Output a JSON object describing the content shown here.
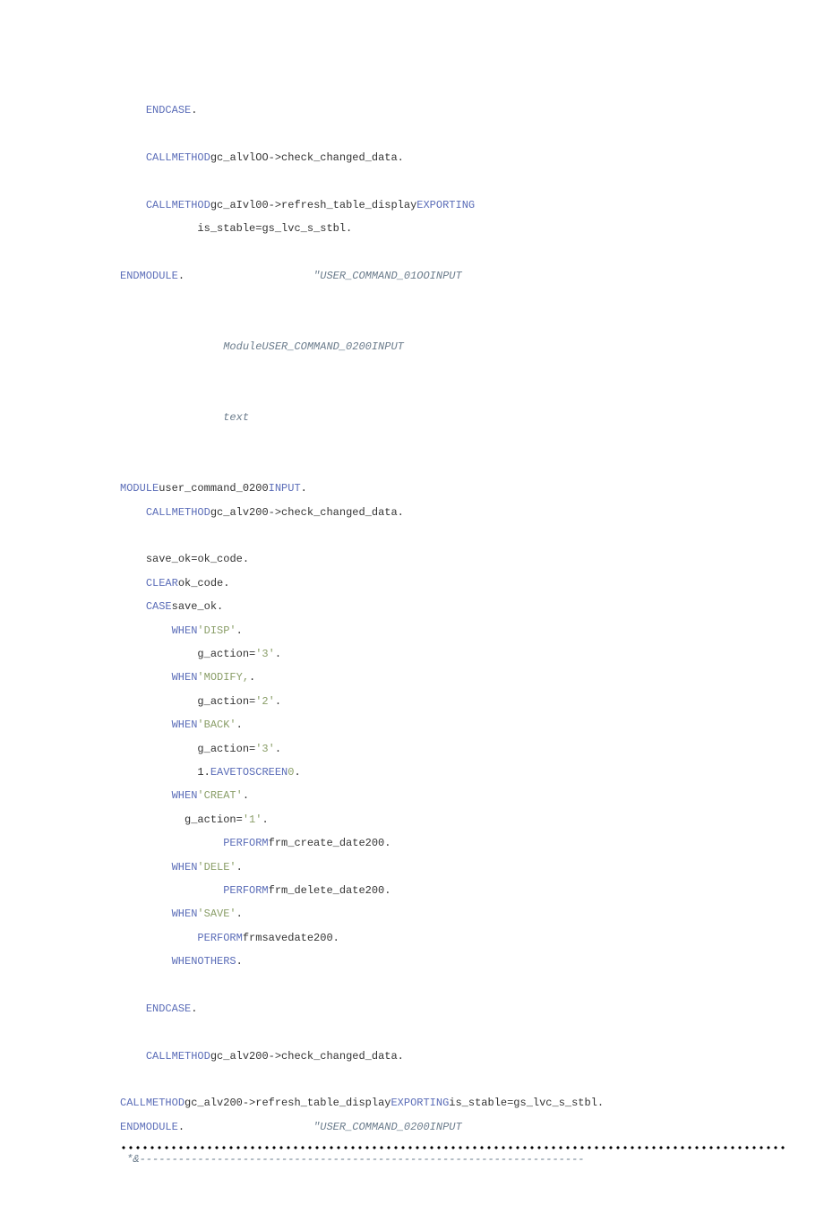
{
  "lines": [
    {
      "indent": 2,
      "segs": [
        {
          "t": "ENDCASE",
          "c": "kw"
        },
        {
          "t": "."
        }
      ]
    },
    {
      "blank": true
    },
    {
      "indent": 2,
      "segs": [
        {
          "t": "CALL",
          "c": "kw"
        },
        {
          "t": "METHOD",
          "c": "kw"
        },
        {
          "t": "gc_alvlOO->check_changed_data."
        }
      ]
    },
    {
      "blank": true
    },
    {
      "indent": 2,
      "segs": [
        {
          "t": "CALL",
          "c": "kw"
        },
        {
          "t": "METHOD",
          "c": "kw"
        },
        {
          "t": "gc_aIvl00->refresh_table_display"
        },
        {
          "t": "EXPORTING",
          "c": "kw"
        }
      ]
    },
    {
      "indent": 6,
      "segs": [
        {
          "t": "is_stable"
        },
        {
          "t": "="
        },
        {
          "t": "gs_lvc_s_stbl."
        }
      ]
    },
    {
      "blank": true
    },
    {
      "indent": 0,
      "segs": [
        {
          "t": "ENDMODULE",
          "c": "kw"
        },
        {
          "t": ".                    "
        },
        {
          "t": "\"USER_COMMAND_01OOINPUT",
          "c": "cmt"
        }
      ]
    },
    {
      "blank": true
    },
    {
      "blank": true
    },
    {
      "indent": 8,
      "segs": [
        {
          "t": "ModuleUSER_COMMAND_0200INPUT",
          "c": "cmt"
        }
      ]
    },
    {
      "blank": true
    },
    {
      "blank": true
    },
    {
      "indent": 8,
      "segs": [
        {
          "t": "text",
          "c": "cmt"
        }
      ]
    },
    {
      "blank": true
    },
    {
      "blank": true
    },
    {
      "indent": 0,
      "segs": [
        {
          "t": "MODULE",
          "c": "kw"
        },
        {
          "t": "user_command_0200"
        },
        {
          "t": "INPUT",
          "c": "kw"
        },
        {
          "t": "."
        }
      ]
    },
    {
      "indent": 2,
      "segs": [
        {
          "t": "CALL",
          "c": "kw"
        },
        {
          "t": "METHOD",
          "c": "kw"
        },
        {
          "t": "gc_alv200->check_changed_data."
        }
      ]
    },
    {
      "blank": true
    },
    {
      "indent": 2,
      "segs": [
        {
          "t": "save_ok"
        },
        {
          "t": "="
        },
        {
          "t": "ok_code."
        }
      ]
    },
    {
      "indent": 2,
      "segs": [
        {
          "t": "CLEAR",
          "c": "kw"
        },
        {
          "t": "ok_code."
        }
      ]
    },
    {
      "indent": 2,
      "segs": [
        {
          "t": "CASE",
          "c": "kw"
        },
        {
          "t": "save_ok."
        }
      ]
    },
    {
      "indent": 4,
      "segs": [
        {
          "t": "WHEN",
          "c": "kw"
        },
        {
          "t": "'DISP'",
          "c": "lit"
        },
        {
          "t": "."
        }
      ]
    },
    {
      "indent": 6,
      "segs": [
        {
          "t": "g_action"
        },
        {
          "t": "="
        },
        {
          "t": "'3'",
          "c": "lit"
        },
        {
          "t": "."
        }
      ]
    },
    {
      "indent": 4,
      "segs": [
        {
          "t": "WHEN",
          "c": "kw"
        },
        {
          "t": "'MODIFY,",
          "c": "lit"
        },
        {
          "t": "."
        }
      ]
    },
    {
      "indent": 6,
      "segs": [
        {
          "t": "g_action"
        },
        {
          "t": "="
        },
        {
          "t": "'2'",
          "c": "lit"
        },
        {
          "t": "."
        }
      ]
    },
    {
      "indent": 4,
      "segs": [
        {
          "t": "WHEN",
          "c": "kw"
        },
        {
          "t": "'BACK'",
          "c": "lit"
        },
        {
          "t": "."
        }
      ]
    },
    {
      "indent": 6,
      "segs": [
        {
          "t": "g_action"
        },
        {
          "t": "="
        },
        {
          "t": "'3'",
          "c": "lit"
        },
        {
          "t": "."
        }
      ]
    },
    {
      "indent": 6,
      "segs": [
        {
          "t": "1."
        },
        {
          "t": "EAVE",
          "c": "kw"
        },
        {
          "t": "TO",
          "c": "kw"
        },
        {
          "t": "SCREEN",
          "c": "kw"
        },
        {
          "t": "0",
          "c": "lit"
        },
        {
          "t": "."
        }
      ]
    },
    {
      "indent": 4,
      "segs": [
        {
          "t": "WHEN",
          "c": "kw"
        },
        {
          "t": "'CREAT'",
          "c": "lit"
        },
        {
          "t": "."
        }
      ]
    },
    {
      "indent": 5,
      "segs": [
        {
          "t": "g_action"
        },
        {
          "t": "="
        },
        {
          "t": "'1'",
          "c": "lit"
        },
        {
          "t": "."
        }
      ]
    },
    {
      "indent": 8,
      "segs": [
        {
          "t": "PERFORM",
          "c": "kw"
        },
        {
          "t": "frm_create_date200."
        }
      ]
    },
    {
      "indent": 4,
      "segs": [
        {
          "t": "WHEN",
          "c": "kw"
        },
        {
          "t": "'DELE'",
          "c": "lit"
        },
        {
          "t": "."
        }
      ]
    },
    {
      "indent": 8,
      "segs": [
        {
          "t": "PERFORM",
          "c": "kw"
        },
        {
          "t": "frm_delete_date200."
        }
      ]
    },
    {
      "indent": 4,
      "segs": [
        {
          "t": "WHEN",
          "c": "kw"
        },
        {
          "t": "'SAVE'",
          "c": "lit"
        },
        {
          "t": "."
        }
      ]
    },
    {
      "indent": 6,
      "segs": [
        {
          "t": "PERFORM",
          "c": "kw"
        },
        {
          "t": "frmsavedate200."
        }
      ]
    },
    {
      "indent": 4,
      "segs": [
        {
          "t": "WHEN",
          "c": "kw"
        },
        {
          "t": "OTHERS",
          "c": "kw"
        },
        {
          "t": "."
        }
      ]
    },
    {
      "blank": true
    },
    {
      "indent": 2,
      "segs": [
        {
          "t": "ENDCASE",
          "c": "kw"
        },
        {
          "t": "."
        }
      ]
    },
    {
      "blank": true
    },
    {
      "indent": 2,
      "segs": [
        {
          "t": "CALL",
          "c": "kw"
        },
        {
          "t": "METHOD",
          "c": "kw"
        },
        {
          "t": "gc_alv200->check_changed_data."
        }
      ]
    },
    {
      "blank": true
    },
    {
      "indent": 0,
      "segs": [
        {
          "t": "CALL",
          "c": "kw"
        },
        {
          "t": "METHOD",
          "c": "kw"
        },
        {
          "t": "gc_alv200->refresh_table_display"
        },
        {
          "t": "EXPORTING",
          "c": "kw"
        },
        {
          "t": "is_stable"
        },
        {
          "t": "="
        },
        {
          "t": "gs_lvc_s_stbl."
        }
      ]
    },
    {
      "indent": 0,
      "segs": [
        {
          "t": "ENDMODULE",
          "c": "kw"
        },
        {
          "t": ".                    "
        },
        {
          "t": "\"USER_COMMAND_0200INPUT",
          "c": "cmt"
        }
      ]
    }
  ],
  "amp_line": " *&---------------------------------------------------------------------"
}
